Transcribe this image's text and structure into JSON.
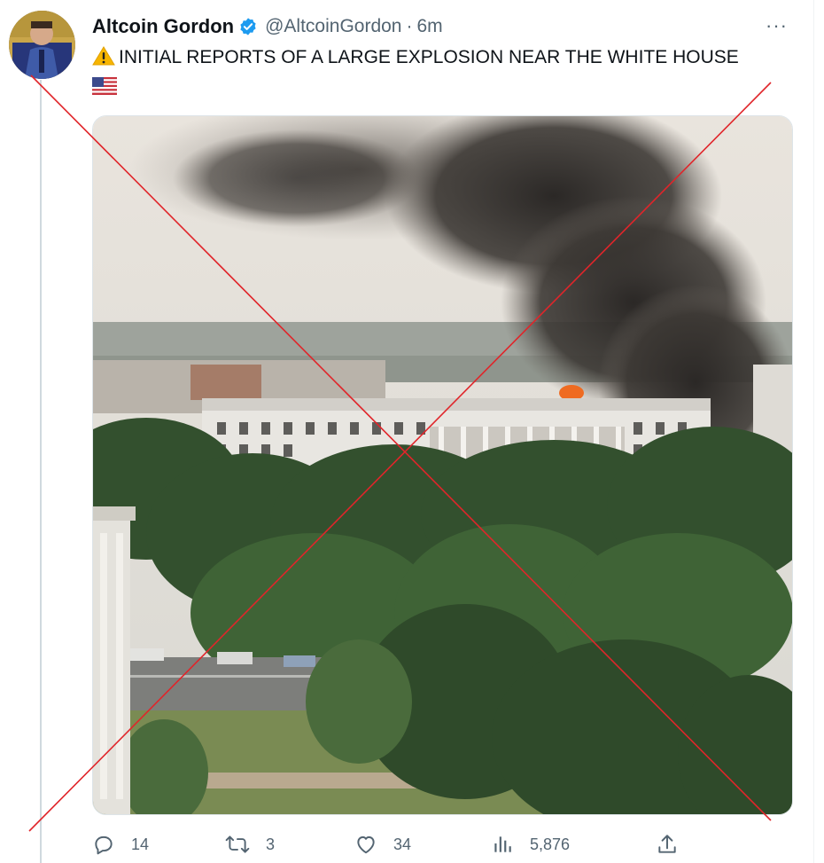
{
  "author": {
    "name": "Altcoin Gordon",
    "handle": "@AltcoinGordon",
    "separator": "·",
    "time": "6m"
  },
  "tweet": {
    "text": "INITIAL REPORTS OF A LARGE EXPLOSION NEAR THE WHITE HOUSE",
    "leading_emoji": "warning-sign",
    "trailing_emoji": "us-flag"
  },
  "more_label": "···",
  "actions": {
    "replies": "14",
    "retweets": "3",
    "likes": "34",
    "views": "5,876"
  },
  "icons": [
    "verified-badge-icon",
    "warning-icon",
    "us-flag-icon",
    "more-icon",
    "reply-icon",
    "retweet-icon",
    "like-icon",
    "views-icon",
    "share-icon"
  ],
  "colors": {
    "text": "#0f1419",
    "secondary": "#536471",
    "verified": "#1d9bf0",
    "cross_mark": "#e0252a"
  }
}
